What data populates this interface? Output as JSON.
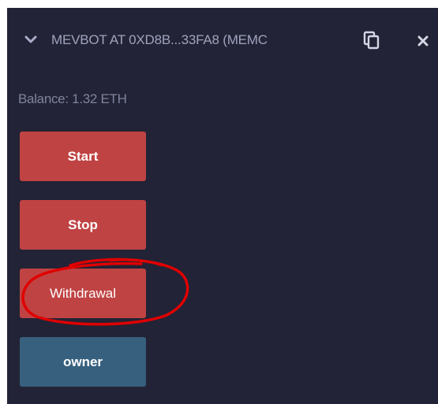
{
  "header": {
    "title": "MEVBOT AT 0XD8B...33FA8 (MEMC",
    "chevron_icon": "chevron-down-icon",
    "copy_icon": "copy-icon",
    "close_icon": "close-icon"
  },
  "balance": {
    "text": "Balance: 1.32 ETH"
  },
  "buttons": {
    "start_label": "Start",
    "stop_label": "Stop",
    "withdrawal_label": "Withdrawal",
    "owner_label": "owner"
  },
  "colors": {
    "panel_bg": "#222336",
    "action_red": "#c04343",
    "call_blue": "#37607e",
    "annotation_red": "#e00000",
    "title_text": "#9fa3bc"
  },
  "annotation": {
    "shape": "freehand-circle",
    "target": "withdrawal-button"
  }
}
